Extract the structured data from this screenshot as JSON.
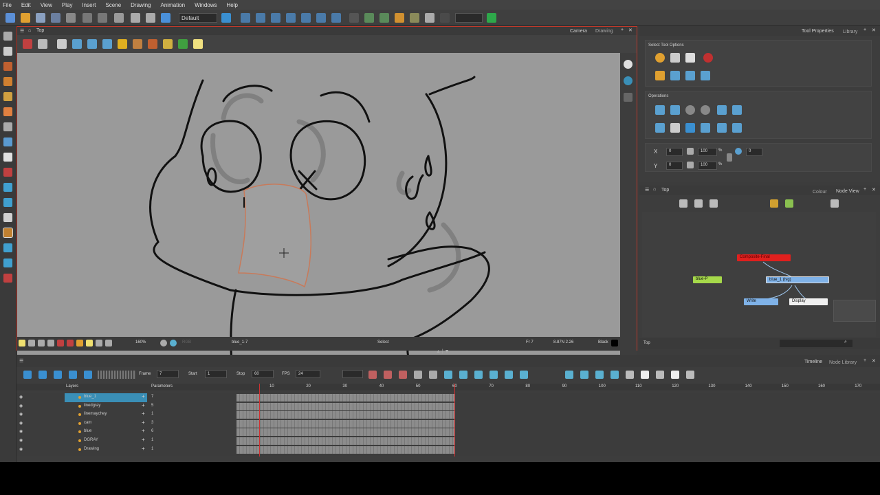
{
  "menu": [
    "File",
    "Edit",
    "View",
    "Play",
    "Insert",
    "Scene",
    "Drawing",
    "Animation",
    "Windows",
    "Help"
  ],
  "toolbar": {
    "workspace": "Default"
  },
  "camera_view": {
    "title": "Top",
    "tab_camera": "Camera",
    "tab_drawing": "Drawing",
    "zoom": "160%",
    "drawing_name": "blue_1-7",
    "tool": "Select",
    "frame": "Fr 7",
    "coords": "8.87N 2.26",
    "color_name": "Black",
    "tool_field": "RGB"
  },
  "tool_properties": {
    "tab_main": "Tool Properties",
    "tab_library": "Library",
    "section_select": "Select Tool Options",
    "section_operations": "Operations",
    "x_label": "X",
    "y_label": "Y",
    "x_value": "0",
    "y_value": "0",
    "w_value": "100",
    "h_value": "100",
    "pct": "%",
    "angle_value": "0"
  },
  "node_view": {
    "title": "Top",
    "tab_colour": "Colour",
    "tab_node_view": "Node View",
    "footer": "Top",
    "nodes": {
      "red": "Composite-Final",
      "blue_p": "blue-P",
      "blue_tvg": "blue_1 (tvg)",
      "write": "Write",
      "display": "Display"
    }
  },
  "timeline": {
    "tab_timeline": "Timeline",
    "tab_node_library": "Node Library",
    "frame_label": "Frame",
    "frame_value": "7",
    "start_label": "Start",
    "start_value": "1",
    "stop_label": "Stop",
    "stop_value": "60",
    "fps_label": "FPS",
    "fps_value": "24",
    "layers_header": "Layers",
    "params_header": "Parameters",
    "layers": [
      {
        "name": "blue_1",
        "val": "7"
      },
      {
        "name": "linedgray",
        "val": "5"
      },
      {
        "name": "linemaychey",
        "val": "1"
      },
      {
        "name": "cam",
        "val": "3"
      },
      {
        "name": "blue",
        "val": "6"
      },
      {
        "name": "DGRAY",
        "val": "1"
      },
      {
        "name": "Drawing",
        "val": "1"
      }
    ],
    "ruler": [
      "10",
      "20",
      "30",
      "40",
      "50",
      "60",
      "70",
      "80",
      "90",
      "100",
      "110",
      "120",
      "130",
      "140",
      "150",
      "160",
      "170"
    ]
  },
  "colors": {
    "accent_red": "#c0392b",
    "selected": "#3a8fb7",
    "node_red": "#e0201e",
    "node_green": "#a6d94a",
    "node_blue": "#7fb2e8"
  }
}
